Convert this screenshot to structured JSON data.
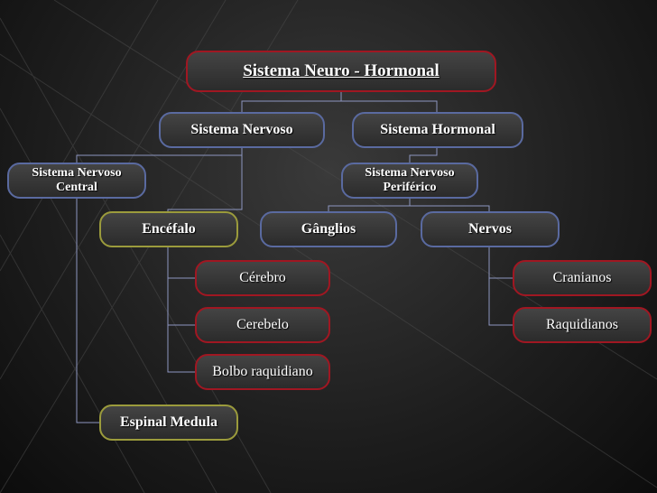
{
  "nodes": {
    "root": "Sistema Neuro - Hormonal",
    "nervoso": "Sistema Nervoso",
    "hormonal": "Sistema Hormonal",
    "snc": "Sistema Nervoso Central",
    "snp": "Sistema Nervoso Periférico",
    "encefalo": "Encéfalo",
    "ganglios": "Gânglios",
    "nervos": "Nervos",
    "cerebro": "Cérebro",
    "cerebelo": "Cerebelo",
    "bolbo": "Bolbo raquidiano",
    "espinal": "Espinal Medula",
    "cranianos": "Cranianos",
    "raquidianos": "Raquidianos"
  },
  "colors": {
    "red_border": "#a01722",
    "blue_border": "#5a6aa0",
    "olive_border": "#9b9b3c",
    "connector": "#8d96c0"
  }
}
